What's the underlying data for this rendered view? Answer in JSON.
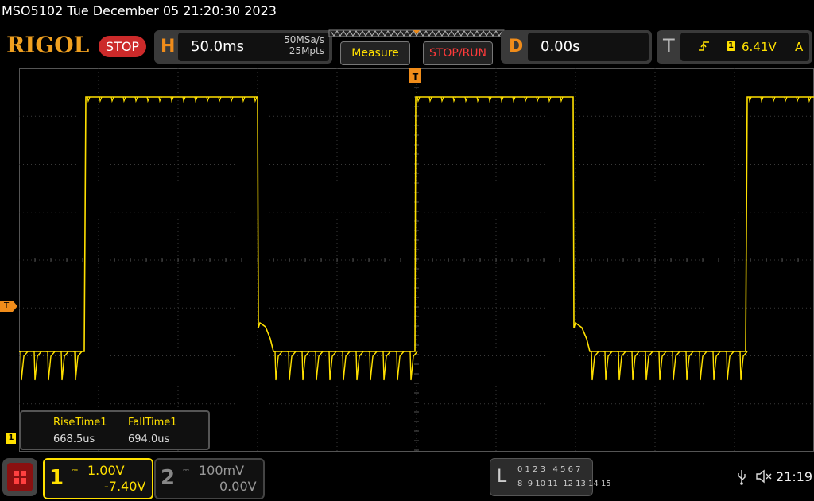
{
  "header": {
    "model_datetime": "MSO5102  Tue December 05 21:20:30 2023",
    "logo": "RIGOL",
    "run_state": "STOP"
  },
  "horizontal": {
    "letter": "H",
    "timebase": "50.0ms",
    "sample_rate": "50MSa/s",
    "memory_depth": "25Mpts"
  },
  "buttons": {
    "measure": "Measure",
    "stop_run": "STOP/RUN"
  },
  "delay": {
    "letter": "D",
    "value": "0.00s"
  },
  "trigger": {
    "letter": "T",
    "channel": "1",
    "level": "6.41V",
    "mode": "A"
  },
  "markers": {
    "trigger_position": "T",
    "trigger_level": "T",
    "channel1_ground": "1"
  },
  "measurements": {
    "items": [
      {
        "name": "RiseTime1",
        "value": "668.5us"
      },
      {
        "name": "FallTime1",
        "value": "694.0us"
      }
    ]
  },
  "channels": [
    {
      "number": "1",
      "scale": "1.00V",
      "offset": "-7.40V",
      "color": "#ffe000",
      "active": true
    },
    {
      "number": "2",
      "scale": "100mV",
      "offset": "0.00V",
      "color": "#888888",
      "active": false
    }
  ],
  "logic": {
    "letter": "L",
    "row1": "0 1 2 3   4 5 6 7",
    "row2": "8  9 10 11  12 13 14 15"
  },
  "status": {
    "time": "21:19"
  },
  "colors": {
    "trace": "#ffe000",
    "accent": "#f08c1a",
    "stop": "#cc2a2a"
  }
}
